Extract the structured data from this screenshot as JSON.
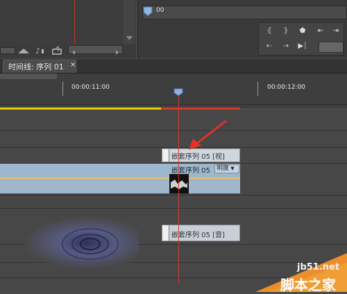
{
  "source_monitor": {
    "toolbar_icons": [
      "mountain-icon",
      "music-note-icon",
      "export-icon"
    ]
  },
  "program_monitor": {
    "timecode_fragment": "00",
    "transport_icons": [
      "mark-in-icon",
      "mark-out-icon",
      "marker-icon",
      "go-to-in-icon",
      "go-to-out-icon",
      "step-back-icon",
      "step-forward-icon",
      "play-range-icon",
      "lift-icon"
    ]
  },
  "timeline": {
    "tab_label": "时间线: 序列 01",
    "tab_close": "×",
    "ruler_timecodes": [
      "00:00:11:00",
      "00:00:12:00"
    ],
    "video_clip_header": "嵌套序列 05 [视]",
    "video_clip_label": "嵌套序列 05",
    "video_clip_effect": "明度",
    "audio_clip_label": "嵌套序列 05 [音]"
  },
  "colors": {
    "work_area": "#e6d000",
    "render_bar": "#d43a2a",
    "playhead": "#d23a2a",
    "video_track": "#9eb7cc",
    "annotation_arrow": "#e0332a"
  },
  "watermark": {
    "url": "jb51.net",
    "brand": "脚本之家"
  }
}
